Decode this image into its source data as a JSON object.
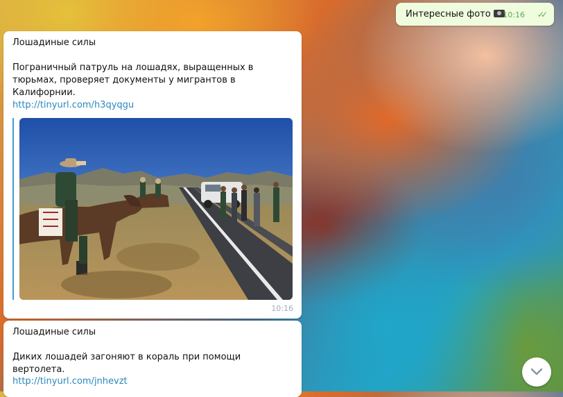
{
  "outgoing": {
    "text": "Интересные фото",
    "time": "10:16",
    "status_icon": "double-check-icon",
    "attachment_icon": "camera-icon"
  },
  "messages": [
    {
      "title": "Лошадиные силы",
      "body": "Пограничный патруль на лошадях, выращенных в тюрьмах, проверяет документы у мигрантов в Калифорнии.",
      "link": "http://tinyurl.com/h3qyqgu",
      "time": "10:16"
    },
    {
      "title": "Лошадиные силы",
      "body": "Диких лошадей загоняют в кораль при помощи вертолета.",
      "link": "http://tinyurl.com/jnhevzt"
    }
  ],
  "colors": {
    "link": "#2a88bd",
    "quote_bar": "#3d9fd8",
    "outgoing_bubble": "#effdde",
    "read_check": "#5da55b"
  }
}
